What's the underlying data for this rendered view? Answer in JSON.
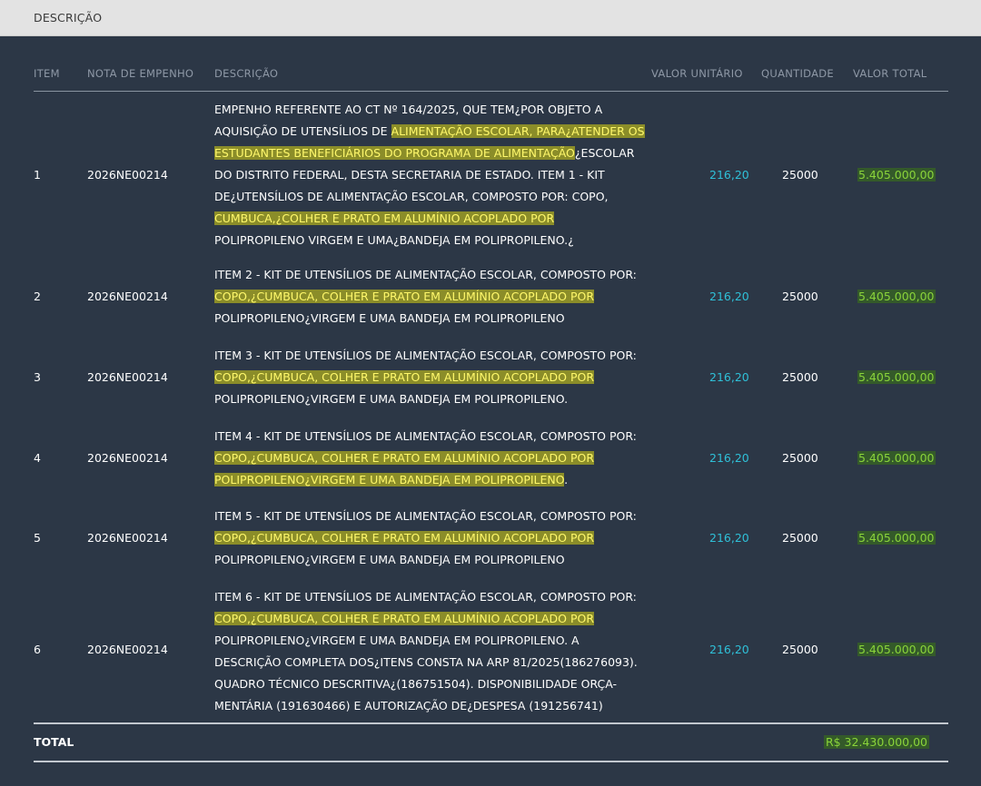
{
  "header": {
    "title": "DESCRIÇÃO"
  },
  "columns": {
    "item": "ITEM",
    "nota": "NOTA DE EMPENHO",
    "descricao": "DESCRIÇÃO",
    "valor_unitario": "VALOR UNITÁRIO",
    "quantidade": "QUANTIDADE",
    "valor_total": "VALOR TOTAL"
  },
  "rows": [
    {
      "item": "1",
      "nota": "2026NE00214",
      "lines": [
        "EMPENHO REFERENTE AO CT Nº 164/2025, QUE TEM¿POR OBJETO A",
        "AQUISIÇÃO DE UTENSÍLIOS DE ",
        "ALIMENTAÇÃO ESCOLAR, PARA¿ATENDER OS",
        "ESTUDANTES BENEFICIÁRIOS DO PROGRAMA DE ALIMENTAÇÃO",
        "¿ESCOLAR",
        "DO DISTRITO FEDERAL, DESTA SECRETARIA DE ESTADO. ITEM 1 - KIT",
        "DE¿UTENSÍLIOS DE ALIMENTAÇÃO ESCOLAR, COMPOSTO POR: COPO,",
        "CUMBUCA,¿COLHER E PRATO EM ALUMÍNIO ACOPLADO POR",
        "POLIPROPILENO VIRGEM E UMA¿BANDEJA EM POLIPROPILENO.¿"
      ],
      "unit": "216,20",
      "qty": "25000",
      "total": "5.405.000,00"
    },
    {
      "item": "2",
      "nota": "2026NE00214",
      "lines": [
        "ITEM 2 - KIT DE UTENSÍLIOS DE ALIMENTAÇÃO ESCOLAR, COMPOSTO POR:",
        "COPO,¿CUMBUCA, COLHER E PRATO EM ALUMÍNIO ACOPLADO POR",
        "POLIPROPILENO¿VIRGEM E UMA BANDEJA EM POLIPROPILENO"
      ],
      "unit": "216,20",
      "qty": "25000",
      "total": "5.405.000,00"
    },
    {
      "item": "3",
      "nota": "2026NE00214",
      "lines": [
        "ITEM 3 - KIT DE UTENSÍLIOS DE ALIMENTAÇÃO ESCOLAR, COMPOSTO POR:",
        "COPO,¿CUMBUCA, COLHER E PRATO EM ALUMÍNIO ACOPLADO POR",
        "POLIPROPILENO¿VIRGEM E UMA BANDEJA EM POLIPROPILENO."
      ],
      "unit": "216,20",
      "qty": "25000",
      "total": "5.405.000,00"
    },
    {
      "item": "4",
      "nota": "2026NE00214",
      "lines": [
        "ITEM 4 - KIT DE UTENSÍLIOS DE ALIMENTAÇÃO ESCOLAR, COMPOSTO POR:",
        "COPO,¿CUMBUCA, COLHER E PRATO EM ALUMÍNIO ACOPLADO POR",
        "POLIPROPILENO¿VIRGEM E UMA BANDEJA EM POLIPROPILENO",
        "."
      ],
      "unit": "216,20",
      "qty": "25000",
      "total": "5.405.000,00"
    },
    {
      "item": "5",
      "nota": "2026NE00214",
      "lines": [
        "ITEM 5 - KIT DE UTENSÍLIOS DE ALIMENTAÇÃO ESCOLAR, COMPOSTO POR:",
        "COPO,¿CUMBUCA, COLHER E PRATO EM ALUMÍNIO ACOPLADO POR",
        "POLIPROPILENO¿VIRGEM E UMA BANDEJA EM POLIPROPILENO"
      ],
      "unit": "216,20",
      "qty": "25000",
      "total": "5.405.000,00"
    },
    {
      "item": "6",
      "nota": "2026NE00214",
      "lines": [
        "ITEM 6 - KIT DE UTENSÍLIOS DE ALIMENTAÇÃO ESCOLAR, COMPOSTO POR:",
        "COPO,¿CUMBUCA, COLHER E PRATO EM ALUMÍNIO ACOPLADO POR",
        "POLIPROPILENO¿VIRGEM E UMA BANDEJA EM POLIPROPILENO. A",
        "DESCRIÇÃO COMPLETA DOS¿ITENS CONSTA NA ARP 81/2025(186276093).",
        "QUADRO TÉCNICO DESCRITIVA¿(186751504). DISPONIBILIDADE ORÇA-",
        "MENTÁRIA (191630466) E AUTORIZAÇÃO DE¿DESPESA (191256741)"
      ],
      "unit": "216,20",
      "qty": "25000",
      "total": "5.405.000,00"
    }
  ],
  "footer": {
    "label": "TOTAL",
    "value": "R$ 32.430.000,00"
  },
  "colors": {
    "background": "#2c3746",
    "unit_value": "#2fc0d8",
    "total_value": "#8ad43a",
    "highlight": "#fff86b"
  }
}
